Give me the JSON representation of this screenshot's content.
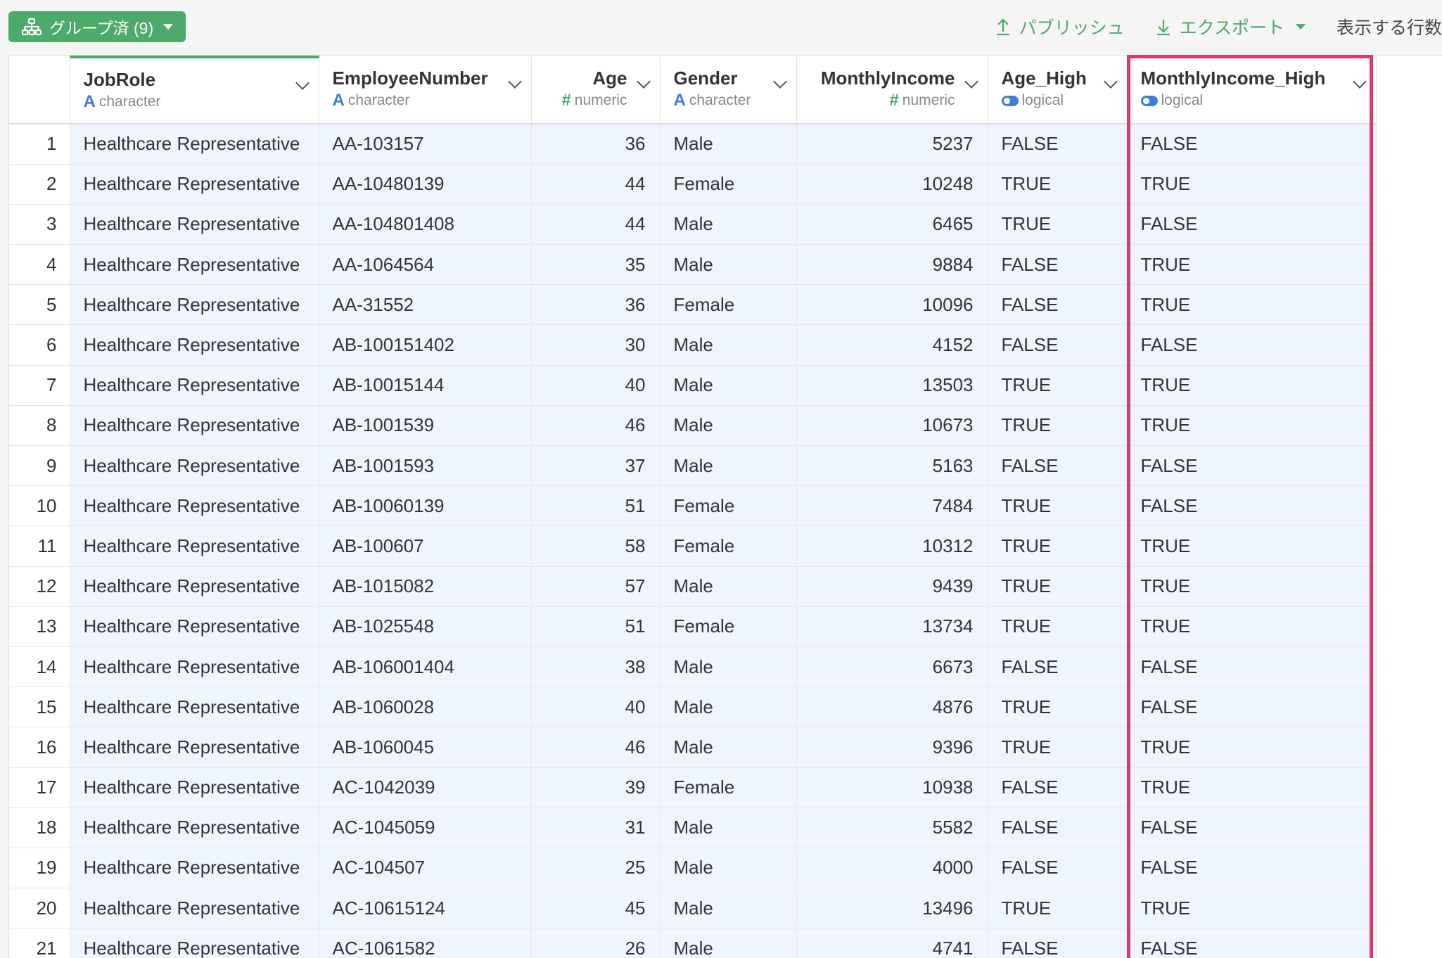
{
  "toolbar": {
    "group_label": "グループ済 (9)",
    "publish_label": "パブリッシュ",
    "export_label": "エクスポート",
    "rows_label": "表示する行数"
  },
  "columns": [
    {
      "name": "JobRole",
      "type": "character",
      "type_icon": "A"
    },
    {
      "name": "EmployeeNumber",
      "type": "character",
      "type_icon": "A"
    },
    {
      "name": "Age",
      "type": "numeric",
      "type_icon": "#"
    },
    {
      "name": "Gender",
      "type": "character",
      "type_icon": "A"
    },
    {
      "name": "MonthlyIncome",
      "type": "numeric",
      "type_icon": "#"
    },
    {
      "name": "Age_High",
      "type": "logical",
      "type_icon": "toggle"
    },
    {
      "name": "MonthlyIncome_High",
      "type": "logical",
      "type_icon": "toggle"
    }
  ],
  "rows": [
    [
      "1",
      "Healthcare Representative",
      "AA-103157",
      "36",
      "Male",
      "5237",
      "FALSE",
      "FALSE"
    ],
    [
      "2",
      "Healthcare Representative",
      "AA-10480139",
      "44",
      "Female",
      "10248",
      "TRUE",
      "TRUE"
    ],
    [
      "3",
      "Healthcare Representative",
      "AA-104801408",
      "44",
      "Male",
      "6465",
      "TRUE",
      "FALSE"
    ],
    [
      "4",
      "Healthcare Representative",
      "AA-1064564",
      "35",
      "Male",
      "9884",
      "FALSE",
      "TRUE"
    ],
    [
      "5",
      "Healthcare Representative",
      "AA-31552",
      "36",
      "Female",
      "10096",
      "FALSE",
      "TRUE"
    ],
    [
      "6",
      "Healthcare Representative",
      "AB-100151402",
      "30",
      "Male",
      "4152",
      "FALSE",
      "FALSE"
    ],
    [
      "7",
      "Healthcare Representative",
      "AB-10015144",
      "40",
      "Male",
      "13503",
      "TRUE",
      "TRUE"
    ],
    [
      "8",
      "Healthcare Representative",
      "AB-1001539",
      "46",
      "Male",
      "10673",
      "TRUE",
      "TRUE"
    ],
    [
      "9",
      "Healthcare Representative",
      "AB-1001593",
      "37",
      "Male",
      "5163",
      "FALSE",
      "FALSE"
    ],
    [
      "10",
      "Healthcare Representative",
      "AB-10060139",
      "51",
      "Female",
      "7484",
      "TRUE",
      "FALSE"
    ],
    [
      "11",
      "Healthcare Representative",
      "AB-100607",
      "58",
      "Female",
      "10312",
      "TRUE",
      "TRUE"
    ],
    [
      "12",
      "Healthcare Representative",
      "AB-1015082",
      "57",
      "Male",
      "9439",
      "TRUE",
      "TRUE"
    ],
    [
      "13",
      "Healthcare Representative",
      "AB-1025548",
      "51",
      "Female",
      "13734",
      "TRUE",
      "TRUE"
    ],
    [
      "14",
      "Healthcare Representative",
      "AB-106001404",
      "38",
      "Male",
      "6673",
      "FALSE",
      "FALSE"
    ],
    [
      "15",
      "Healthcare Representative",
      "AB-1060028",
      "40",
      "Male",
      "4876",
      "TRUE",
      "FALSE"
    ],
    [
      "16",
      "Healthcare Representative",
      "AB-1060045",
      "46",
      "Male",
      "9396",
      "TRUE",
      "TRUE"
    ],
    [
      "17",
      "Healthcare Representative",
      "AC-1042039",
      "39",
      "Female",
      "10938",
      "FALSE",
      "TRUE"
    ],
    [
      "18",
      "Healthcare Representative",
      "AC-1045059",
      "31",
      "Male",
      "5582",
      "FALSE",
      "FALSE"
    ],
    [
      "19",
      "Healthcare Representative",
      "AC-104507",
      "25",
      "Male",
      "4000",
      "FALSE",
      "FALSE"
    ],
    [
      "20",
      "Healthcare Representative",
      "AC-10615124",
      "45",
      "Male",
      "13496",
      "TRUE",
      "TRUE"
    ],
    [
      "21",
      "Healthcare Representative",
      "AC-1061582",
      "26",
      "Male",
      "4741",
      "FALSE",
      "FALSE"
    ]
  ],
  "colors": {
    "accent": "#4caa6a",
    "highlight": "#e0386a",
    "type_character": "#3b7fd6",
    "type_numeric": "#4caa6a",
    "cell_bg": "#eef5fe"
  },
  "icons": {
    "group": "hierarchy-icon",
    "publish": "upload-icon",
    "export": "download-icon",
    "column_menu": "chevron-down-icon"
  }
}
